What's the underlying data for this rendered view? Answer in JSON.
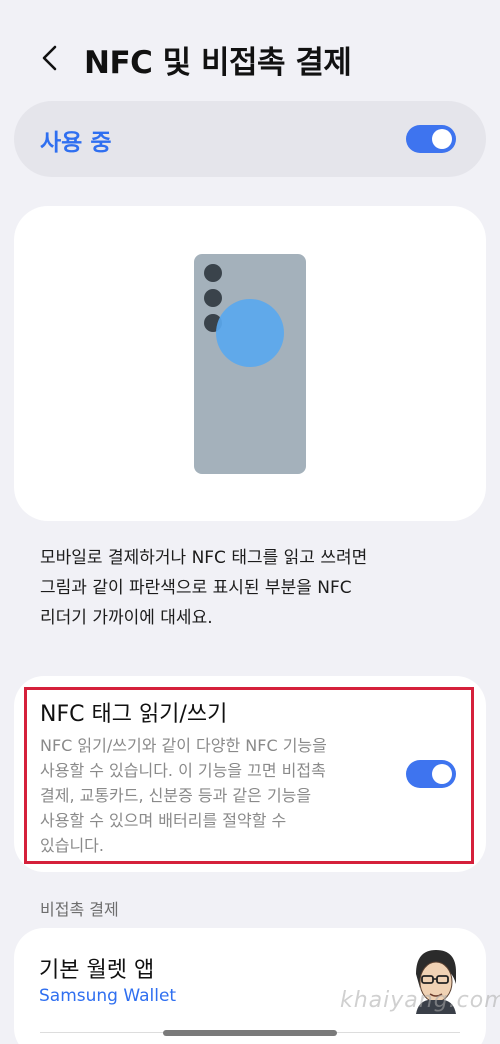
{
  "header": {
    "title": "NFC 및 비접촉 결제",
    "back_icon": "chevron-left-icon"
  },
  "master_switch": {
    "label": "사용 중",
    "on": true,
    "accent": "#3e74ef",
    "label_color": "#2f6ff0"
  },
  "illustration": {
    "nfc_area_color": "#5aa8ee"
  },
  "description": "모바일로 결제하거나 NFC 태그를 읽고 쓰려면\n그림과 같이 파란색으로 표시된 부분을 NFC\n리더기 가까이에 대세요.",
  "nfc_tag": {
    "title": "NFC 태그 읽기/쓰기",
    "description": "NFC 읽기/쓰기와 같이 다양한 NFC 기능을\n사용할 수 있습니다. 이 기능을 끄면 비접촉\n결제, 교통카드, 신분증 등과 같은 기능을\n사용할 수 있으며 배터리를 절약할 수\n있습니다.",
    "on": true,
    "highlight_color": "#d5203b"
  },
  "contactless": {
    "section_label": "비접촉 결제",
    "default_wallet": {
      "title": "기본 월렛 앱",
      "value": "Samsung Wallet"
    }
  },
  "watermark": "khaiyang.com"
}
